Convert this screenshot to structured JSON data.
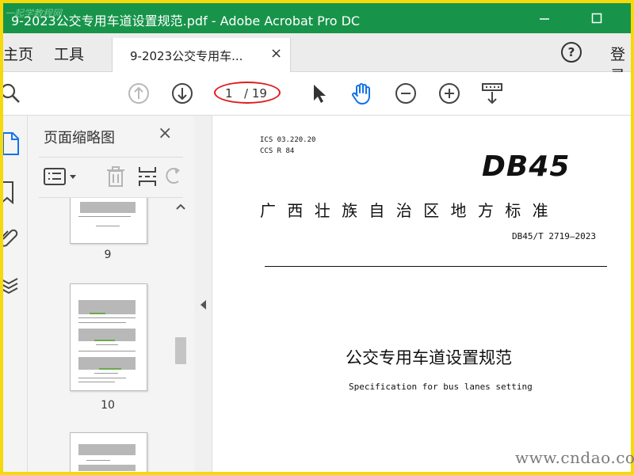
{
  "window": {
    "title": "9-2023公交专用车道设置规范.pdf - Adobe Acrobat Pro DC",
    "watermark": "一起学教程网",
    "title_bar_color": "#17944a"
  },
  "nav": {
    "home": "主页",
    "tools": "工具",
    "help_icon": "?",
    "login": "登录"
  },
  "tab": {
    "label": "9-2023公交专用车...",
    "close": "×"
  },
  "toolbar": {
    "current_page": "1",
    "total_pages": "/ 19"
  },
  "panel": {
    "title": "页面缩略图",
    "close": "×",
    "thumbnails": [
      {
        "number": "9"
      },
      {
        "number": "10"
      },
      {
        "number": ""
      }
    ]
  },
  "document": {
    "ics": "ICS  03.220.20",
    "ccs": "CCS  R 84",
    "logo": "DB45",
    "authority": "广 西 壮 族 自 治 区 地 方 标 准",
    "code": "DB45/T 2719—2023",
    "title_cn": "公交专用车道设置规范",
    "title_en": "Specification for bus lanes setting"
  },
  "site_watermark": "www.cndao.com",
  "colors": {
    "accent_blue": "#1473e6",
    "annotation_red": "#e01b1b",
    "frame_yellow": "#f5d90a"
  }
}
